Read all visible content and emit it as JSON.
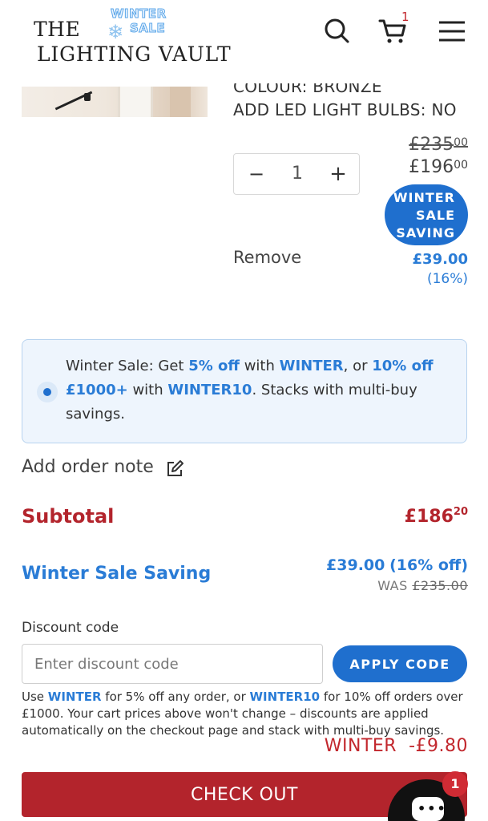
{
  "header": {
    "logo_line1": "THE",
    "logo_line2": "LIGHTING VAULT",
    "badge_line1": "WINTER",
    "badge_line2": "SALE",
    "cart_count": "1",
    "icons": [
      "search-icon",
      "cart-icon",
      "menu-icon"
    ]
  },
  "cart_item": {
    "options": [
      "COLOUR: BRONZE",
      "ADD LED LIGHT BULBS: NO"
    ],
    "quantity": "1",
    "price_was": "£235",
    "price_was_pence": "00",
    "price_now": "£196",
    "price_now_pence": "00",
    "sale_badge": [
      "WINTER",
      "SALE",
      "SAVING"
    ],
    "remove_label": "Remove",
    "saving_amount": "£39.00",
    "saving_percent": "(16%)"
  },
  "promo": {
    "part1": "Winter Sale: Get ",
    "pct1": "5% off",
    "part2": " with ",
    "code1": "WINTER",
    "part3": ", or ",
    "pct2": "10% off",
    "part4": " ",
    "threshold": "£1000+",
    "part5": " with ",
    "code2": "WINTER10",
    "part6": ". Stacks with multi-buy savings."
  },
  "order_note": {
    "label": "Add order note"
  },
  "totals": {
    "subtotal_label": "Subtotal",
    "subtotal_value": "£186",
    "subtotal_pence": "20",
    "winter_label": "Winter Sale Saving",
    "winter_amount": "£39.00",
    "winter_pct": "(16% off)",
    "was_label": "WAS",
    "was_value": "£235.00"
  },
  "discount": {
    "label": "Discount code",
    "placeholder": "Enter discount code",
    "apply_label": "APPLY CODE",
    "note_part1": "Use ",
    "note_code1": "WINTER",
    "note_part2": " for 5% off any order, or ",
    "note_code2": "WINTER10",
    "note_part3": " for 10% off orders over £1000. Your cart prices above won't change – discounts are applied automatically on the checkout page and stack with multi-buy savings.",
    "applied_text": "WINTER  -£9.80"
  },
  "checkout": {
    "label": "CHECK OUT"
  },
  "chat": {
    "badge": "1"
  },
  "colors": {
    "accent_blue": "#1f6fce",
    "link_blue": "#2a7cd6",
    "brand_red": "#b3242c",
    "promo_bg": "#eef5fd"
  }
}
